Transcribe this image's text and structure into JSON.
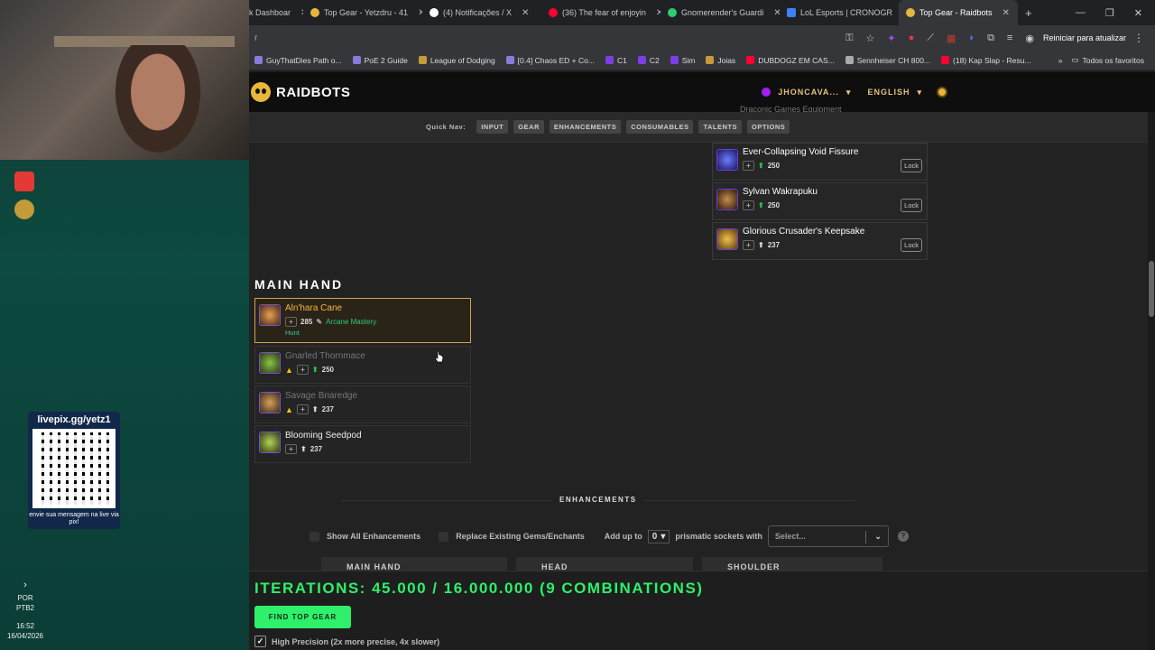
{
  "overlay": {
    "livepix_url": "livepix.gg/yetz1",
    "livepix_msg": "envie sua mensagem na live via pix!",
    "tray_lang": "POR",
    "tray_kb": "PTB2",
    "time": "16:52",
    "date": "16/04/2026"
  },
  "browser": {
    "tabs": [
      {
        "label": "k Dashboar",
        "color": "#4a4a4a"
      },
      {
        "label": "Top Gear - Yetzdru - 41",
        "color": "#e6b53f"
      },
      {
        "label": "(4) Notificações / X",
        "color": "#ffffff"
      },
      {
        "label": "(36) The fear of enjoyin",
        "color": "#ff0033"
      },
      {
        "label": "Gnomerender's Guardi",
        "color": "#2ecc71"
      },
      {
        "label": "LoL Esports | CRONOGR",
        "color": "#3b82f6"
      },
      {
        "label": "Top Gear - Raidbots",
        "color": "#e6b53f"
      }
    ],
    "new_tab": "+",
    "update_label": "Reiniciar para atualizar",
    "bookmarks": [
      "GuyThatDies Path o...",
      "PoE 2 Guide",
      "League of Dodging",
      "[0.4] Chaos ED + Co...",
      "C1",
      "C2",
      "Sim",
      "Joias",
      "DUBDOGZ EM CAS...",
      "Sennheiser CH 800...",
      "(18) Kap Slap - Resu..."
    ],
    "bookmarks_more": "»",
    "favorites": "Todos os favoritos"
  },
  "raidbots": {
    "brand": "RAIDBOTS",
    "user": "JHONCAVA...",
    "language": "ENGLISH",
    "quicknav_label": "Quick Nav:",
    "quicknav": [
      "INPUT",
      "GEAR",
      "ENHANCEMENTS",
      "CONSUMABLES",
      "TALENTS",
      "OPTIONS"
    ],
    "faded_header": "Draconic Games Equipment"
  },
  "trinkets": [
    {
      "name": "Ever-Collapsing Void Fissure",
      "ilvl": "250",
      "lock": "Lock",
      "up": true
    },
    {
      "name": "Sylvan Wakrapuku",
      "ilvl": "250",
      "lock": "Lock",
      "up": true
    },
    {
      "name": "Glorious Crusader's Keepsake",
      "ilvl": "237",
      "lock": "Lock",
      "up": false
    }
  ],
  "main_hand": {
    "title": "MAIN HAND",
    "items": [
      {
        "name": "Aln'hara Cane",
        "ilvl": "285",
        "enchant": "Arcane Mastery",
        "tag": "Hunt"
      },
      {
        "name": "Gnarled Thornmace",
        "ilvl": "250"
      },
      {
        "name": "Savage Briaredge",
        "ilvl": "237"
      },
      {
        "name": "Blooming Seedpod",
        "ilvl": "237"
      }
    ]
  },
  "enhancements": {
    "title": "ENHANCEMENTS",
    "show_all": "Show All Enhancements",
    "replace": "Replace Existing Gems/Enchants",
    "add_up_to": "Add up to",
    "sockets_value": "0",
    "sockets_label": "prismatic sockets with",
    "select_placeholder": "Select...",
    "help": "?",
    "slots": [
      "MAIN HAND",
      "HEAD",
      "SHOULDER"
    ]
  },
  "footer": {
    "iterations": "ITERATIONS: 45.000 / 16.000.000 (9 COMBINATIONS)",
    "find_button": "FIND TOP GEAR",
    "high_precision": "High Precision (2x more precise, 4x slower)"
  },
  "colors": {
    "accent_green": "#2ef06a",
    "gold": "#f5b341",
    "epic_border": "#7a4fd8"
  }
}
